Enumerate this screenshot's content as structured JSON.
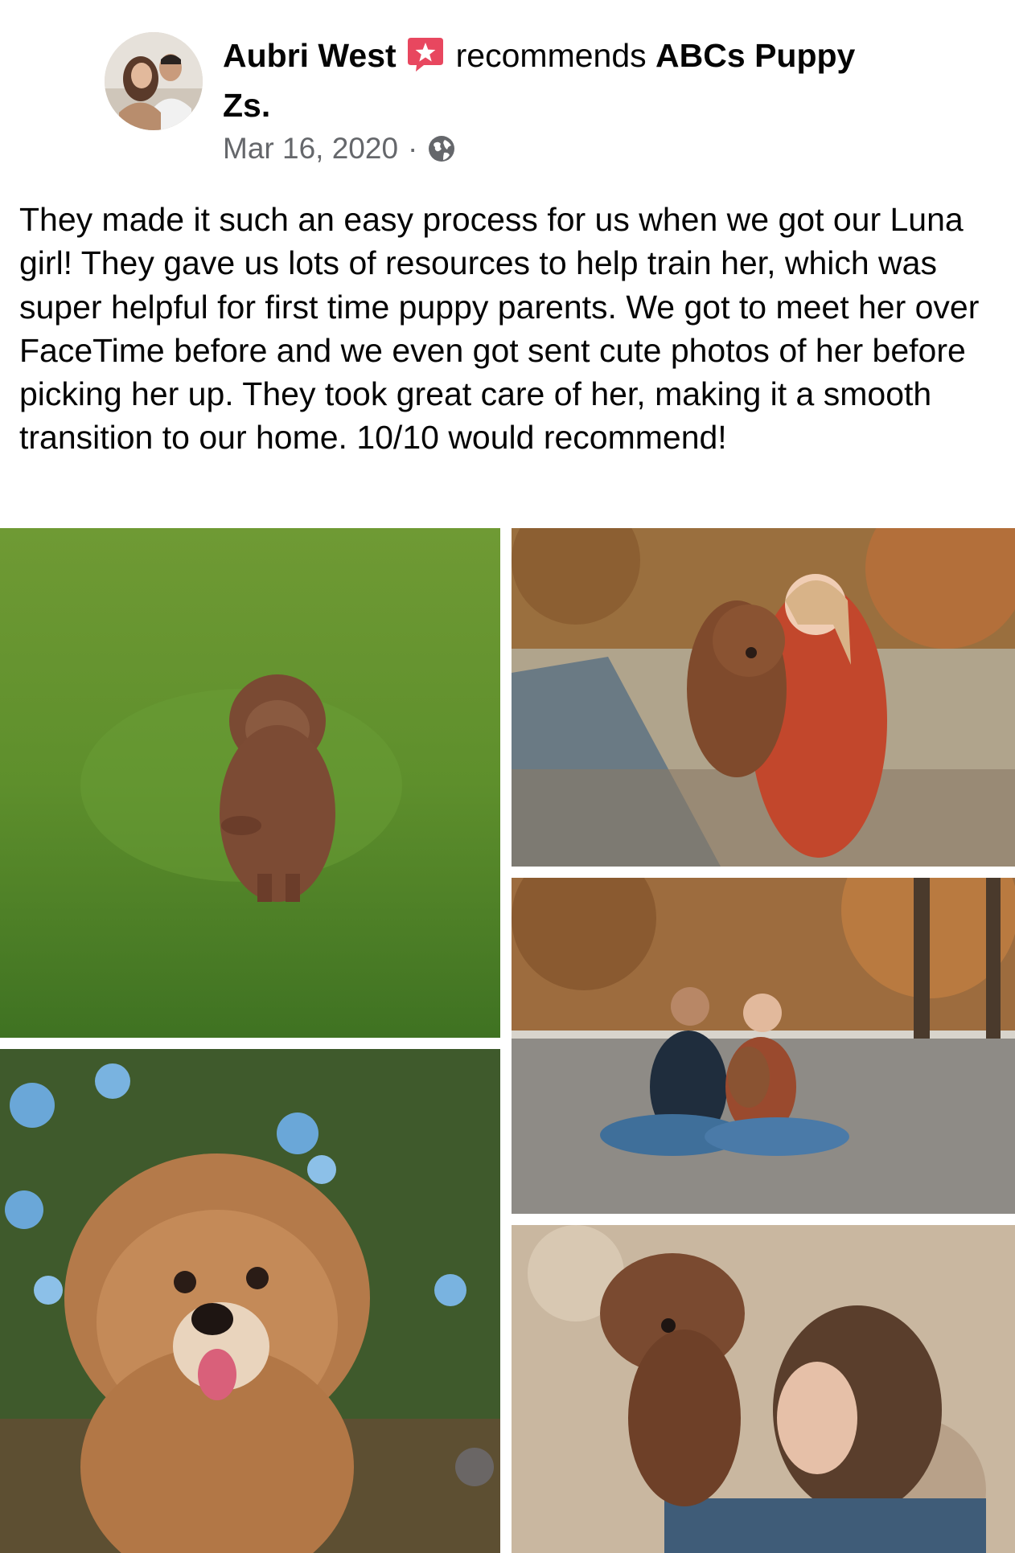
{
  "post": {
    "author_name": "Aubri West",
    "recommend_verb": "recommends",
    "page_name": "ABCs Puppy Zs.",
    "date": "Mar 16, 2020",
    "separator": "·",
    "privacy_icon": "globe-icon",
    "recommend_icon": "recommendation-star-icon",
    "body": "They made it such an easy process for us when we got our Luna girl! They gave us lots of resources to help train her, which was super helpful for first time puppy parents. We got to meet her over FaceTime before and we even got sent cute photos of her before picking her up. They took great care of her, making it a smooth transition to our home. 10/10 would recommend!"
  },
  "colors": {
    "text_primary": "#050505",
    "text_secondary": "#65676b",
    "recommend_badge": "#e8475f"
  },
  "photos": [
    {
      "subject": "puppy sitting on green grass"
    },
    {
      "subject": "puppy in front of blue flowers"
    },
    {
      "subject": "girl holding puppy on autumn street"
    },
    {
      "subject": "couple sitting on street with puppy"
    },
    {
      "subject": "puppy on woman's shoulder"
    }
  ]
}
